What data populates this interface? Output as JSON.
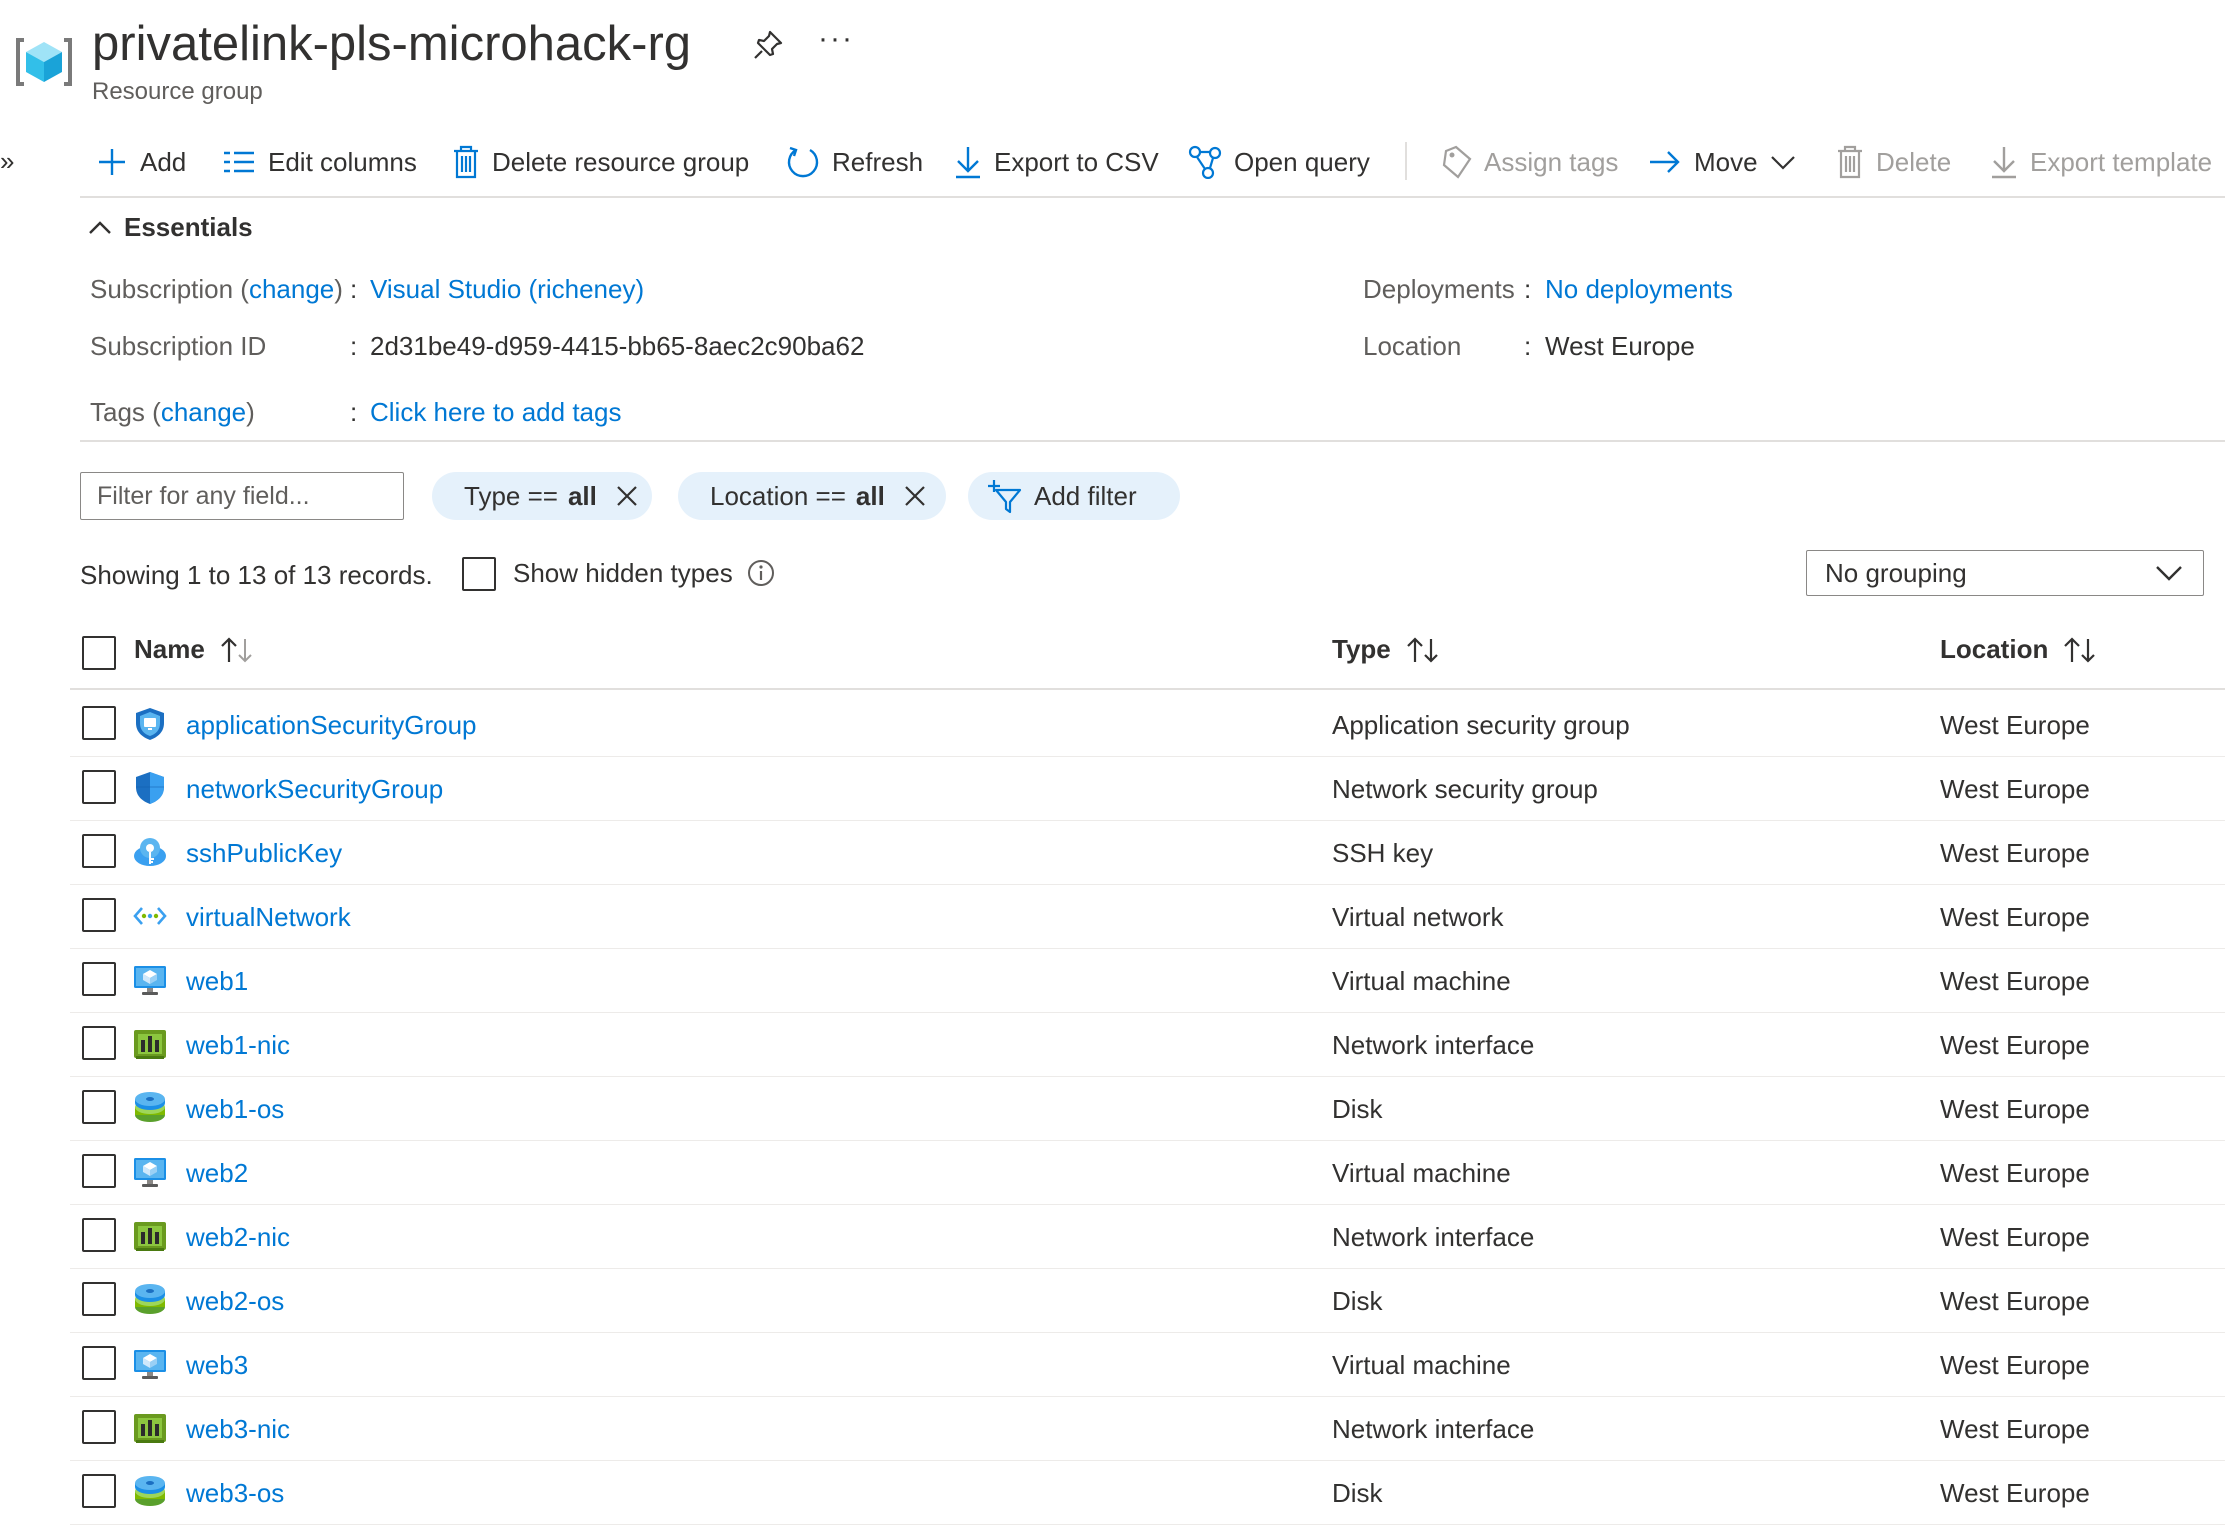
{
  "header": {
    "title": "privatelink-pls-microhack-rg",
    "subtitle": "Resource group",
    "more_label": "···",
    "expand_label": "»"
  },
  "toolbar": {
    "add": "Add",
    "edit_columns": "Edit columns",
    "delete_rg": "Delete resource group",
    "refresh": "Refresh",
    "export_csv": "Export to CSV",
    "open_query": "Open query",
    "assign_tags": "Assign tags",
    "move": "Move",
    "delete": "Delete",
    "export_template": "Export template"
  },
  "essentials": {
    "title": "Essentials",
    "subscription_label": "Subscription",
    "change_link": "change",
    "subscription_value": "Visual Studio (richeney)",
    "subscription_id_label": "Subscription ID",
    "subscription_id_value": "2d31be49-d959-4415-bb65-8aec2c90ba62",
    "tags_label": "Tags",
    "tags_value": "Click here to add tags",
    "deployments_label": "Deployments",
    "deployments_value": "No deployments",
    "location_label": "Location",
    "location_value": "West Europe"
  },
  "filters": {
    "placeholder": "Filter for any field...",
    "type_label": "Type ==",
    "type_value": "all",
    "location_label": "Location ==",
    "location_value": "all",
    "add_filter": "Add filter"
  },
  "records": {
    "showing": "Showing 1 to 13 of 13 records.",
    "show_hidden": "Show hidden types",
    "grouping": "No grouping"
  },
  "table": {
    "columns": {
      "name": "Name",
      "type": "Type",
      "location": "Location"
    },
    "rows": [
      {
        "name": "applicationSecurityGroup",
        "type": "Application security group",
        "location": "West Europe",
        "icon": "asg-icon"
      },
      {
        "name": "networkSecurityGroup",
        "type": "Network security group",
        "location": "West Europe",
        "icon": "nsg-icon"
      },
      {
        "name": "sshPublicKey",
        "type": "SSH key",
        "location": "West Europe",
        "icon": "ssh-key-icon"
      },
      {
        "name": "virtualNetwork",
        "type": "Virtual network",
        "location": "West Europe",
        "icon": "vnet-icon"
      },
      {
        "name": "web1",
        "type": "Virtual machine",
        "location": "West Europe",
        "icon": "vm-icon"
      },
      {
        "name": "web1-nic",
        "type": "Network interface",
        "location": "West Europe",
        "icon": "nic-icon"
      },
      {
        "name": "web1-os",
        "type": "Disk",
        "location": "West Europe",
        "icon": "disk-icon"
      },
      {
        "name": "web2",
        "type": "Virtual machine",
        "location": "West Europe",
        "icon": "vm-icon"
      },
      {
        "name": "web2-nic",
        "type": "Network interface",
        "location": "West Europe",
        "icon": "nic-icon"
      },
      {
        "name": "web2-os",
        "type": "Disk",
        "location": "West Europe",
        "icon": "disk-icon"
      },
      {
        "name": "web3",
        "type": "Virtual machine",
        "location": "West Europe",
        "icon": "vm-icon"
      },
      {
        "name": "web3-nic",
        "type": "Network interface",
        "location": "West Europe",
        "icon": "nic-icon"
      },
      {
        "name": "web3-os",
        "type": "Disk",
        "location": "West Europe",
        "icon": "disk-icon"
      }
    ]
  },
  "colors": {
    "accent": "#0078d4",
    "pill": "#e5f1fb",
    "text": "#323130",
    "muted": "#605e5c",
    "disabled": "#a19f9d"
  }
}
